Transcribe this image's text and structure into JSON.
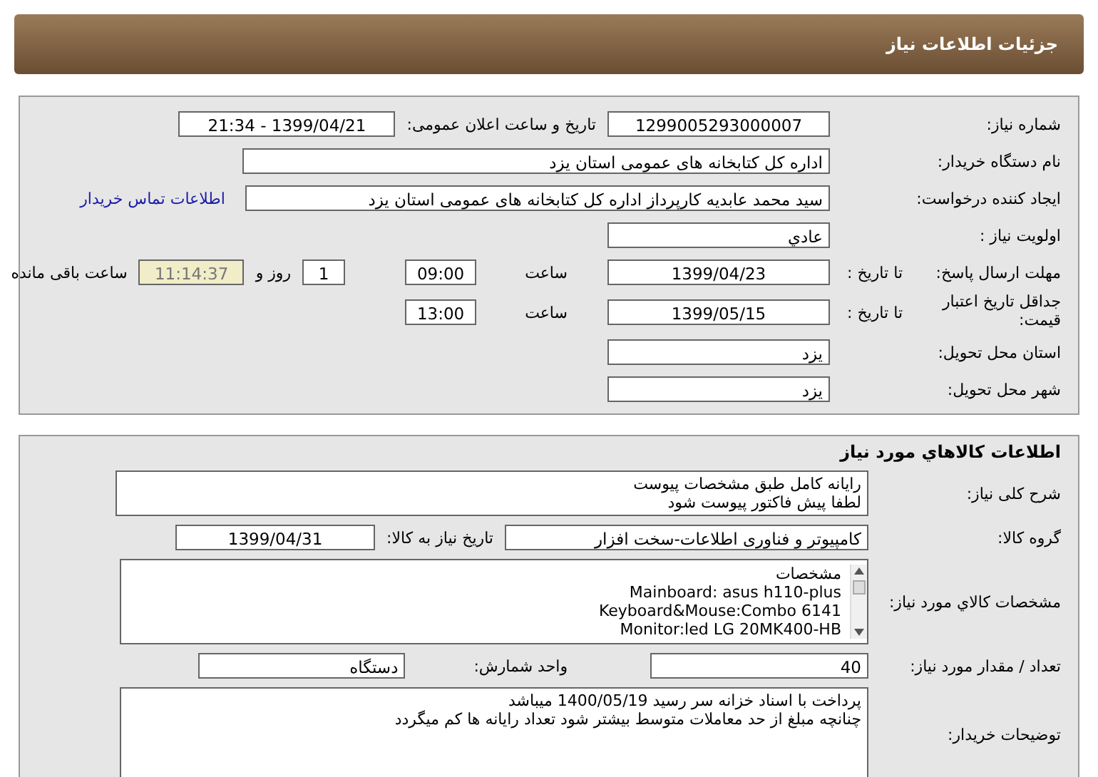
{
  "header": {
    "title": "جزئیات اطلاعات نیاز"
  },
  "need": {
    "need_number": {
      "label": "شماره نیاز:",
      "value": "1299005293000007"
    },
    "announce": {
      "label": "تاریخ و ساعت اعلان عمومی:",
      "value": "1399/04/21 - 21:34"
    },
    "buyer": {
      "label": "نام دستگاه خریدار:",
      "value": "اداره کل کتابخانه های عمومی استان یزد"
    },
    "requester": {
      "label": "ایجاد کننده درخواست:",
      "value": "سید محمد عابدیه کارپرداز اداره کل کتابخانه های عمومی استان یزد",
      "contact_link": "اطلاعات تماس خریدار"
    },
    "priority": {
      "label": "اولویت نیاز :",
      "value": "عادي"
    },
    "deadline": {
      "label": "مهلت ارسال پاسخ:",
      "sublabel": "تا تاریخ :",
      "date": "1399/04/23",
      "time_label": "ساعت",
      "time": "09:00",
      "days": "1",
      "days_label": "روز و",
      "remaining": "11:14:37",
      "remaining_label": "ساعت باقی مانده"
    },
    "validity": {
      "label": "جداقل تاریخ اعتبار قیمت:",
      "sublabel": "تا تاریخ :",
      "date": "1399/05/15",
      "time_label": "ساعت",
      "time": "13:00"
    },
    "province": {
      "label": "استان محل تحویل:",
      "value": "یزد"
    },
    "city": {
      "label": "شهر محل تحویل:",
      "value": "یزد"
    }
  },
  "goods": {
    "title": "اطلاعات کالاهاي مورد نياز",
    "description": {
      "label": "شرح کلی نیاز:",
      "lines": [
        "رایانه کامل طبق مشخصات پیوست",
        "لطفا پیش فاکتور پیوست شود"
      ]
    },
    "group": {
      "label": "گروه کالا:",
      "value": "کامپیوتر و فناوری اطلاعات-سخت افزار"
    },
    "need_date": {
      "label": "تاریخ نیاز به کالا:",
      "value": "1399/04/31"
    },
    "specs": {
      "label": "مشخصات کالاي مورد نياز:",
      "lines": [
        "مشخصات",
        "Mainboard: asus h110-plus",
        "Keyboard&Mouse:Combo 6141",
        "Monitor:led LG 20MK400-HB"
      ]
    },
    "quantity": {
      "label": "تعداد / مقدار مورد نیاز:",
      "value": "40"
    },
    "unit": {
      "label": "واحد شمارش:",
      "value": "دستگاه"
    },
    "buyer_notes": {
      "label": "توضیحات خریدار:",
      "lines": [
        "پرداخت با اسناد خزانه سر رسید 1400/05/19 میباشد",
        "چنانچه مبلغ از حد معاملات متوسط بیشتر شود تعداد رایانه ها کم میگردد"
      ]
    }
  }
}
